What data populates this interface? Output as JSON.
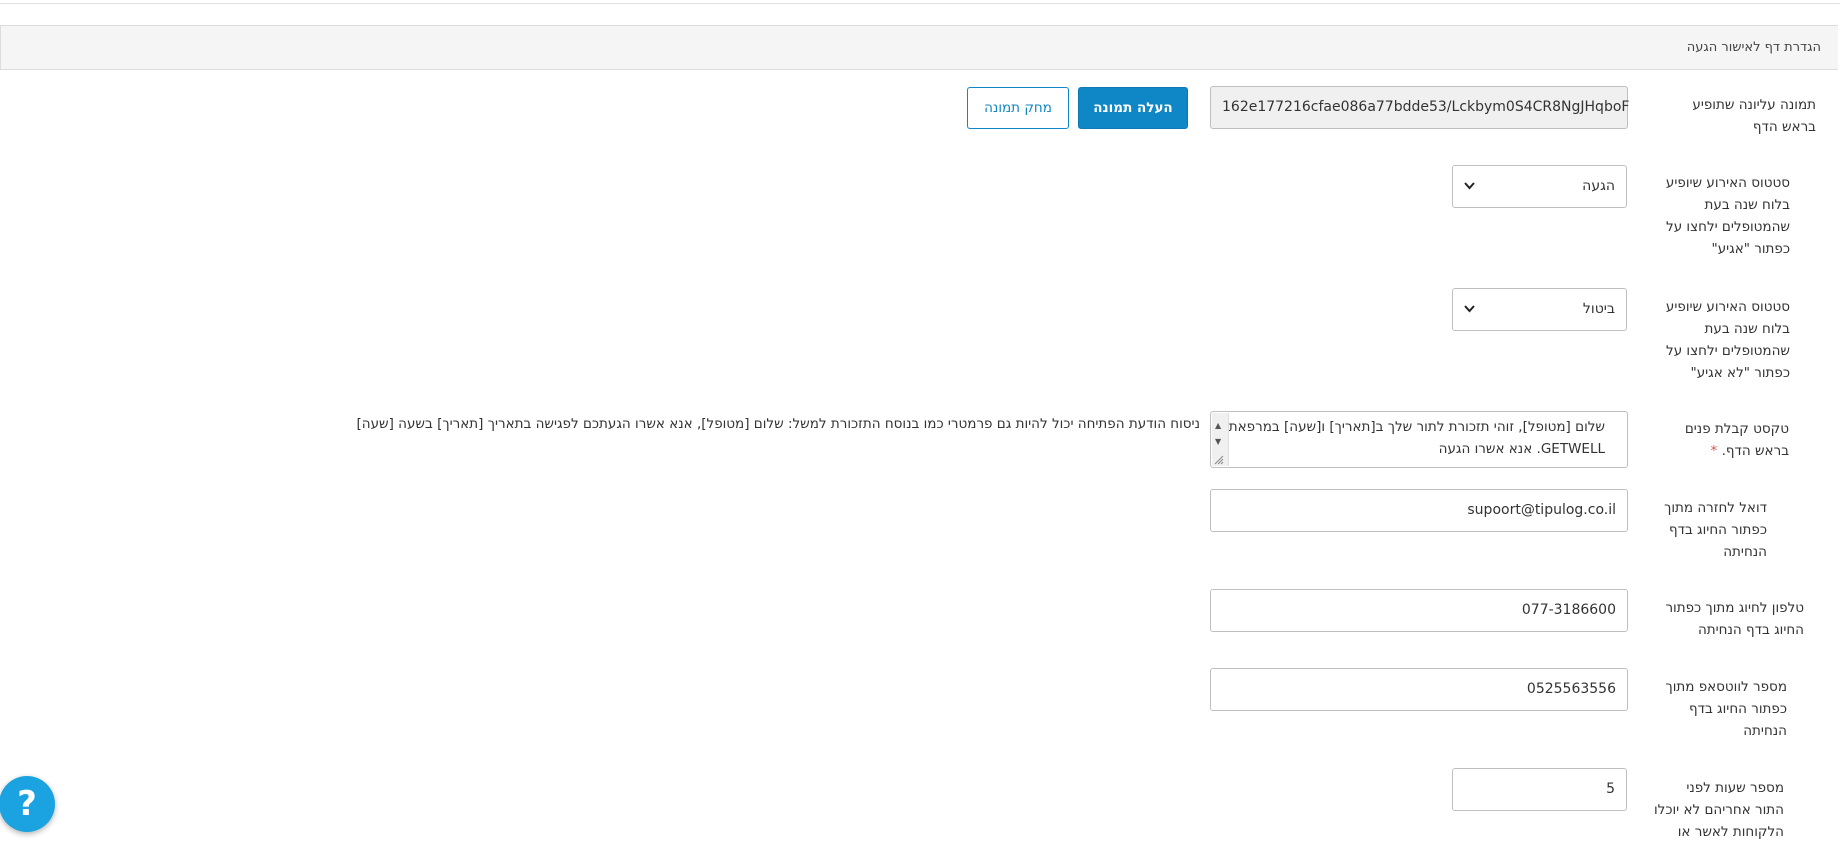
{
  "panel": {
    "title": "הגדרת דף לאישור הגעה"
  },
  "fields": {
    "top_image": {
      "label": "תמונה עליונה שתופיע בראש הדף",
      "value": "162e177216cfae086a77bdde53/Lckbym0S4CR8NgJHqboF",
      "upload_label": "העלה תמונה",
      "delete_label": "מחק תמונה"
    },
    "arrive_status": {
      "label": "סטטוס האירוע שיופיע בלוח שנה בעת שהמטופלים ילחצו על כפתור \"אגיע\"",
      "value": "הגעה"
    },
    "not_arrive_status": {
      "label": "סטטוס האירוע שיופיע בלוח שנה בעת שהמטופלים ילחצו על כפתור \"לא אגיע\"",
      "value": "ביטול"
    },
    "welcome_text": {
      "label": "טקסט קבלת פנים בראש הדף.",
      "required_mark": "*",
      "value": "שלום [מטופל], זוהי תזכורת לתור שלך ב[תאריך] ו[שעה] במרפאת GETWELL. אנא אשרו הגעה",
      "help": "ניסוח הודעת הפתיחה יכול להיות גם פרמטרי כמו בנוסח התזכורת למשל: שלום [מטופל], אנא אשרו הגעתכם לפגישה בתאריך [תאריך] בשעה [שעה]"
    },
    "email": {
      "label": "דואל לחזרה מתוך כפתור החיוג בדף הנחיתה",
      "value": "supoort@tipulog.co.il"
    },
    "phone": {
      "label": "טלפון לחיוג מתוך כפתור החיוג בדף הנחיתה",
      "value": "077-3186600"
    },
    "whatsapp": {
      "label": "מספר לווטסאפ מתוך כפתור החיוג בדף הנחיתה",
      "value": "0525563556"
    },
    "hours_before": {
      "label": "מספר שעות לפני התור אחריהם לא יוכלו הלקוחות לאשר או",
      "value": "5"
    }
  },
  "help_button": {
    "label": "?"
  },
  "colors": {
    "primary": "#0f86c5",
    "help": "#1aa3e0",
    "required": "#d9534f"
  }
}
